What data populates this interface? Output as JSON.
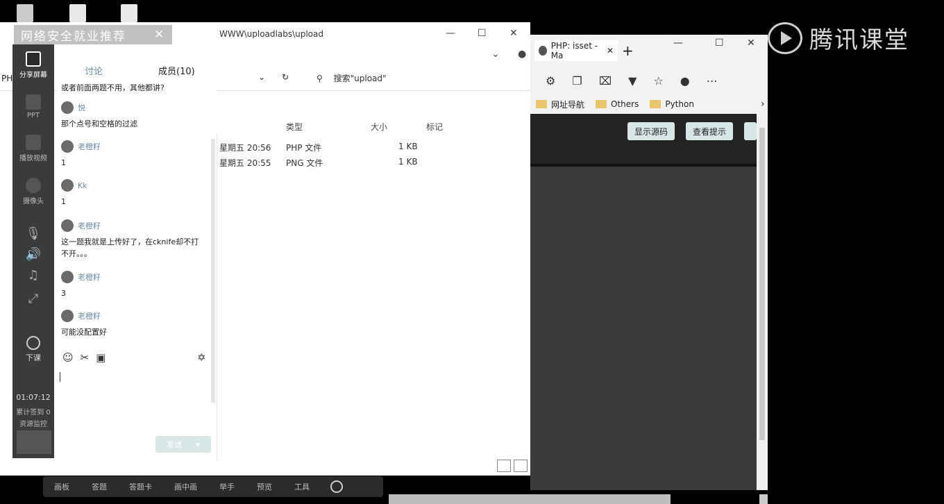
{
  "brand": {
    "name": "腾讯课堂"
  },
  "browser": {
    "tab_label": "PHP: isset - Ma",
    "tab_close": "✕",
    "new_tab": "+",
    "bookmarks": [
      {
        "label": "网址导航"
      },
      {
        "label": "Others"
      },
      {
        "label": "Python"
      }
    ],
    "page_buttons": [
      "显示源码",
      "查看提示"
    ]
  },
  "explorer": {
    "path": "WWW\\uploadlabs\\upload",
    "search_placeholder": "搜索\"upload\"",
    "left_cut_label": "PHP",
    "columns": {
      "type": "类型",
      "size": "大小",
      "tag": "标记"
    },
    "rows": [
      {
        "date": "星期五 20:56",
        "type": "PHP 文件",
        "size": "1 KB"
      },
      {
        "date": "星期五 20:55",
        "type": "PNG 文件",
        "size": "1 KB"
      }
    ]
  },
  "overlay_title": "网络安全就业推荐",
  "sidebar": {
    "items": [
      {
        "label": "分享屏幕"
      },
      {
        "label": "PPT"
      },
      {
        "label": "播放视频"
      },
      {
        "label": "摄像头"
      }
    ],
    "end_class": "下课",
    "timer": "01:07:12",
    "stats": "累计签到 0",
    "resource": "资源监控"
  },
  "chat": {
    "tabs": {
      "discussion": "讨论",
      "members": "成员(10)"
    },
    "messages": [
      {
        "user": "",
        "text": "或者前面两题不用，其他都讲?"
      },
      {
        "user": "悦",
        "text": "那个点号和空格的过滤"
      },
      {
        "user": "老橙籽",
        "text": "1"
      },
      {
        "user": "Kk",
        "text": "1"
      },
      {
        "user": "老橙籽",
        "text": "这一题我就是上传好了，在cknife却不打不开。。。"
      },
      {
        "user": "老橙籽",
        "text": "3"
      },
      {
        "user": "老橙籽",
        "text": "可能没配置好"
      }
    ],
    "send_label": "发送"
  },
  "bottombar": {
    "items": [
      "画板",
      "答题",
      "答题卡",
      "画中画",
      "举手",
      "预览",
      "工具"
    ]
  }
}
